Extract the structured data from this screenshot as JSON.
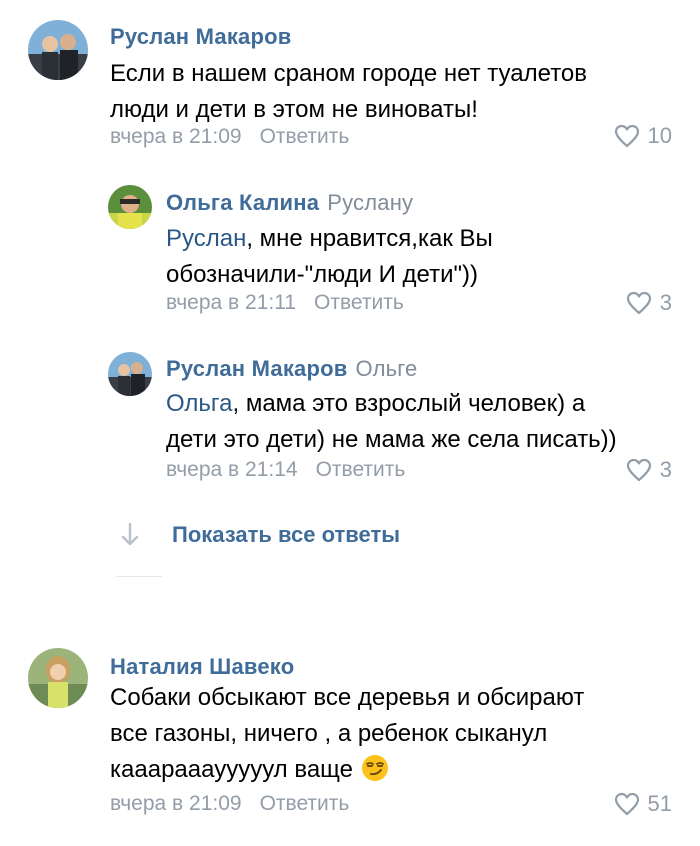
{
  "comments": [
    {
      "author": "Руслан Макаров",
      "reply_to": "",
      "lines": [
        "Если в нашем сраном городе нет туалетов",
        "люди и дети в этом не виноваты!"
      ],
      "time": "вчера в 21:09",
      "reply_label": "Ответить",
      "likes": "10"
    },
    {
      "author": "Ольга Калина",
      "reply_to": "Руслану",
      "mention": "Руслан",
      "line1_rest": ", мне нравится,как Вы",
      "line2": "обозначили-\"люди И дети\"))",
      "time": "вчера в 21:11",
      "reply_label": "Ответить",
      "likes": "3"
    },
    {
      "author": "Руслан Макаров",
      "reply_to": "Ольге",
      "mention": "Ольга",
      "line1_rest": ", мама это взрослый человек) а",
      "line2": "дети это дети) не мама же села писать))",
      "time": "вчера в 21:14",
      "reply_label": "Ответить",
      "likes": "3"
    },
    {
      "author": "Наталия Шавеко",
      "reply_to": "",
      "lines": [
        "Собаки обсыкают все деревья и обсирают",
        "все газоны, ничего , а ребенок сыканул",
        "кааараааууууул ваще"
      ],
      "time": "вчера в 21:09",
      "reply_label": "Ответить",
      "likes": "51"
    }
  ],
  "show_all_replies": "Показать все ответы",
  "icons": {
    "like": "heart-outline-icon",
    "expand": "arrow-down-icon",
    "emoji": "smirking-face-emoji"
  },
  "colors": {
    "author": "#3f6c98",
    "meta": "#939da8",
    "mention": "#2a5885"
  }
}
